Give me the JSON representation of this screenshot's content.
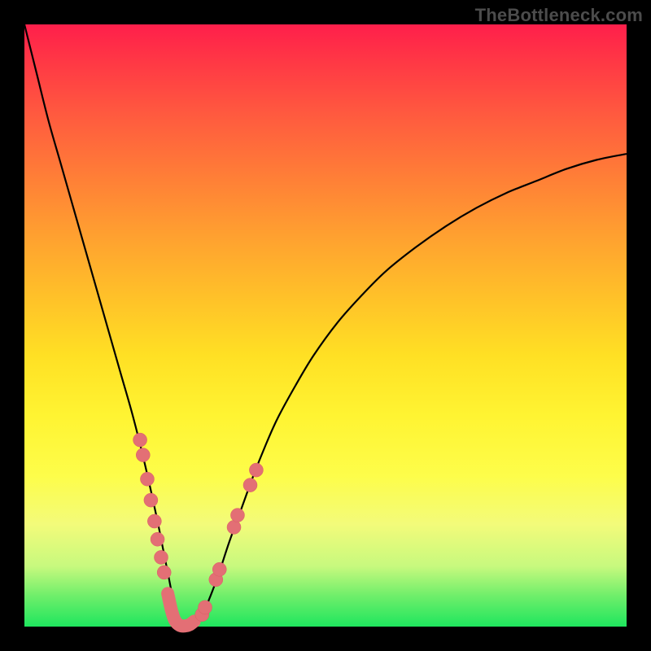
{
  "watermark": {
    "text": "TheBottleneck.com"
  },
  "colors": {
    "curve": "#000000",
    "highlight_fill": "#e36f75",
    "highlight_stroke": "#d95d63"
  },
  "chart_data": {
    "type": "line",
    "title": "",
    "xlabel": "",
    "ylabel": "",
    "xlim": [
      0,
      100
    ],
    "ylim": [
      0,
      100
    ],
    "series": [
      {
        "name": "bottleneck-curve",
        "x": [
          0,
          2,
          4,
          6,
          8,
          10,
          12,
          14,
          16,
          18,
          20,
          22,
          23,
          24,
          25,
          26,
          27,
          28,
          30,
          32,
          34,
          36,
          38,
          40,
          42,
          45,
          48,
          52,
          56,
          60,
          65,
          70,
          75,
          80,
          85,
          90,
          95,
          100
        ],
        "y": [
          100,
          92,
          84,
          77,
          70,
          63,
          56,
          49,
          42,
          35,
          27,
          18,
          13,
          8,
          3,
          0,
          0,
          0,
          3,
          8,
          14,
          19.5,
          25,
          30,
          34.5,
          40,
          45,
          50.5,
          55,
          59,
          63,
          66.5,
          69.5,
          72,
          74,
          76,
          77.5,
          78.5
        ]
      }
    ],
    "highlights": [
      {
        "name": "left-branch-upper-dots",
        "x": [
          19.2,
          19.7
        ],
        "y": [
          31,
          28.5
        ]
      },
      {
        "name": "left-branch-mid-dots",
        "x": [
          20.4,
          21.0,
          21.6,
          22.1
        ],
        "y": [
          24.5,
          21.0,
          17.5,
          14.5
        ]
      },
      {
        "name": "left-branch-low-dots",
        "x": [
          22.7,
          23.2
        ],
        "y": [
          11.5,
          9.0
        ]
      },
      {
        "name": "right-branch-low-dots",
        "x": [
          29.5,
          30.0
        ],
        "y": [
          2.0,
          3.2
        ]
      },
      {
        "name": "right-branch-mid-dots",
        "x": [
          31.8,
          32.4
        ],
        "y": [
          7.8,
          9.5
        ]
      },
      {
        "name": "right-branch-upper1",
        "x": [
          34.8,
          35.4
        ],
        "y": [
          16.5,
          18.5
        ]
      },
      {
        "name": "right-branch-upper2",
        "x": [
          37.5,
          38.5
        ],
        "y": [
          23.5,
          26.0
        ]
      },
      {
        "name": "valley-arc-points",
        "x": [
          23.8,
          24.4,
          25.0,
          25.8,
          26.6,
          27.4,
          28.2
        ],
        "y": [
          5.5,
          2.8,
          1.0,
          0.2,
          0.1,
          0.3,
          0.9
        ]
      }
    ]
  }
}
